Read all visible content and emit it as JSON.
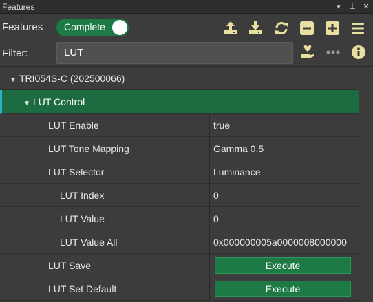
{
  "window": {
    "title": "Features",
    "controls": [
      "▾",
      "⊥",
      "✕"
    ]
  },
  "toolbar": {
    "label": "Features",
    "visibility_toggle": {
      "label": "Complete",
      "on": true
    },
    "buttons": [
      "upload-icon",
      "download-icon",
      "refresh-icon",
      "collapse-all-icon",
      "expand-all-icon",
      "menu-icon"
    ]
  },
  "filter": {
    "label": "Filter:",
    "value": "LUT",
    "buttons": [
      "favorite-icon",
      "more-icon",
      "info-icon"
    ]
  },
  "tree": {
    "device": {
      "label": "TRI054S-C (202500066)"
    },
    "category": {
      "label": "LUT Control"
    },
    "features": [
      {
        "name": "LUT Enable",
        "value": "true",
        "level": 1
      },
      {
        "name": "LUT Tone Mapping",
        "value": "Gamma 0.5",
        "level": 1
      },
      {
        "name": "LUT Selector",
        "value": "Luminance",
        "level": 1
      },
      {
        "name": "LUT Index",
        "value": "0",
        "level": 2
      },
      {
        "name": "LUT Value",
        "value": "0",
        "level": 2
      },
      {
        "name": "LUT Value All",
        "value": "0x000000005a0000008000000",
        "level": 2
      },
      {
        "name": "LUT Save",
        "button": "Execute",
        "level": 1
      },
      {
        "name": "LUT Set Default",
        "button": "Execute",
        "level": 1
      }
    ]
  },
  "colors": {
    "accent_green": "#1d7a45",
    "category_bg": "#1d6b40",
    "icon_yellow": "#e8e0a0",
    "selection_edge": "#2bb0c8"
  }
}
